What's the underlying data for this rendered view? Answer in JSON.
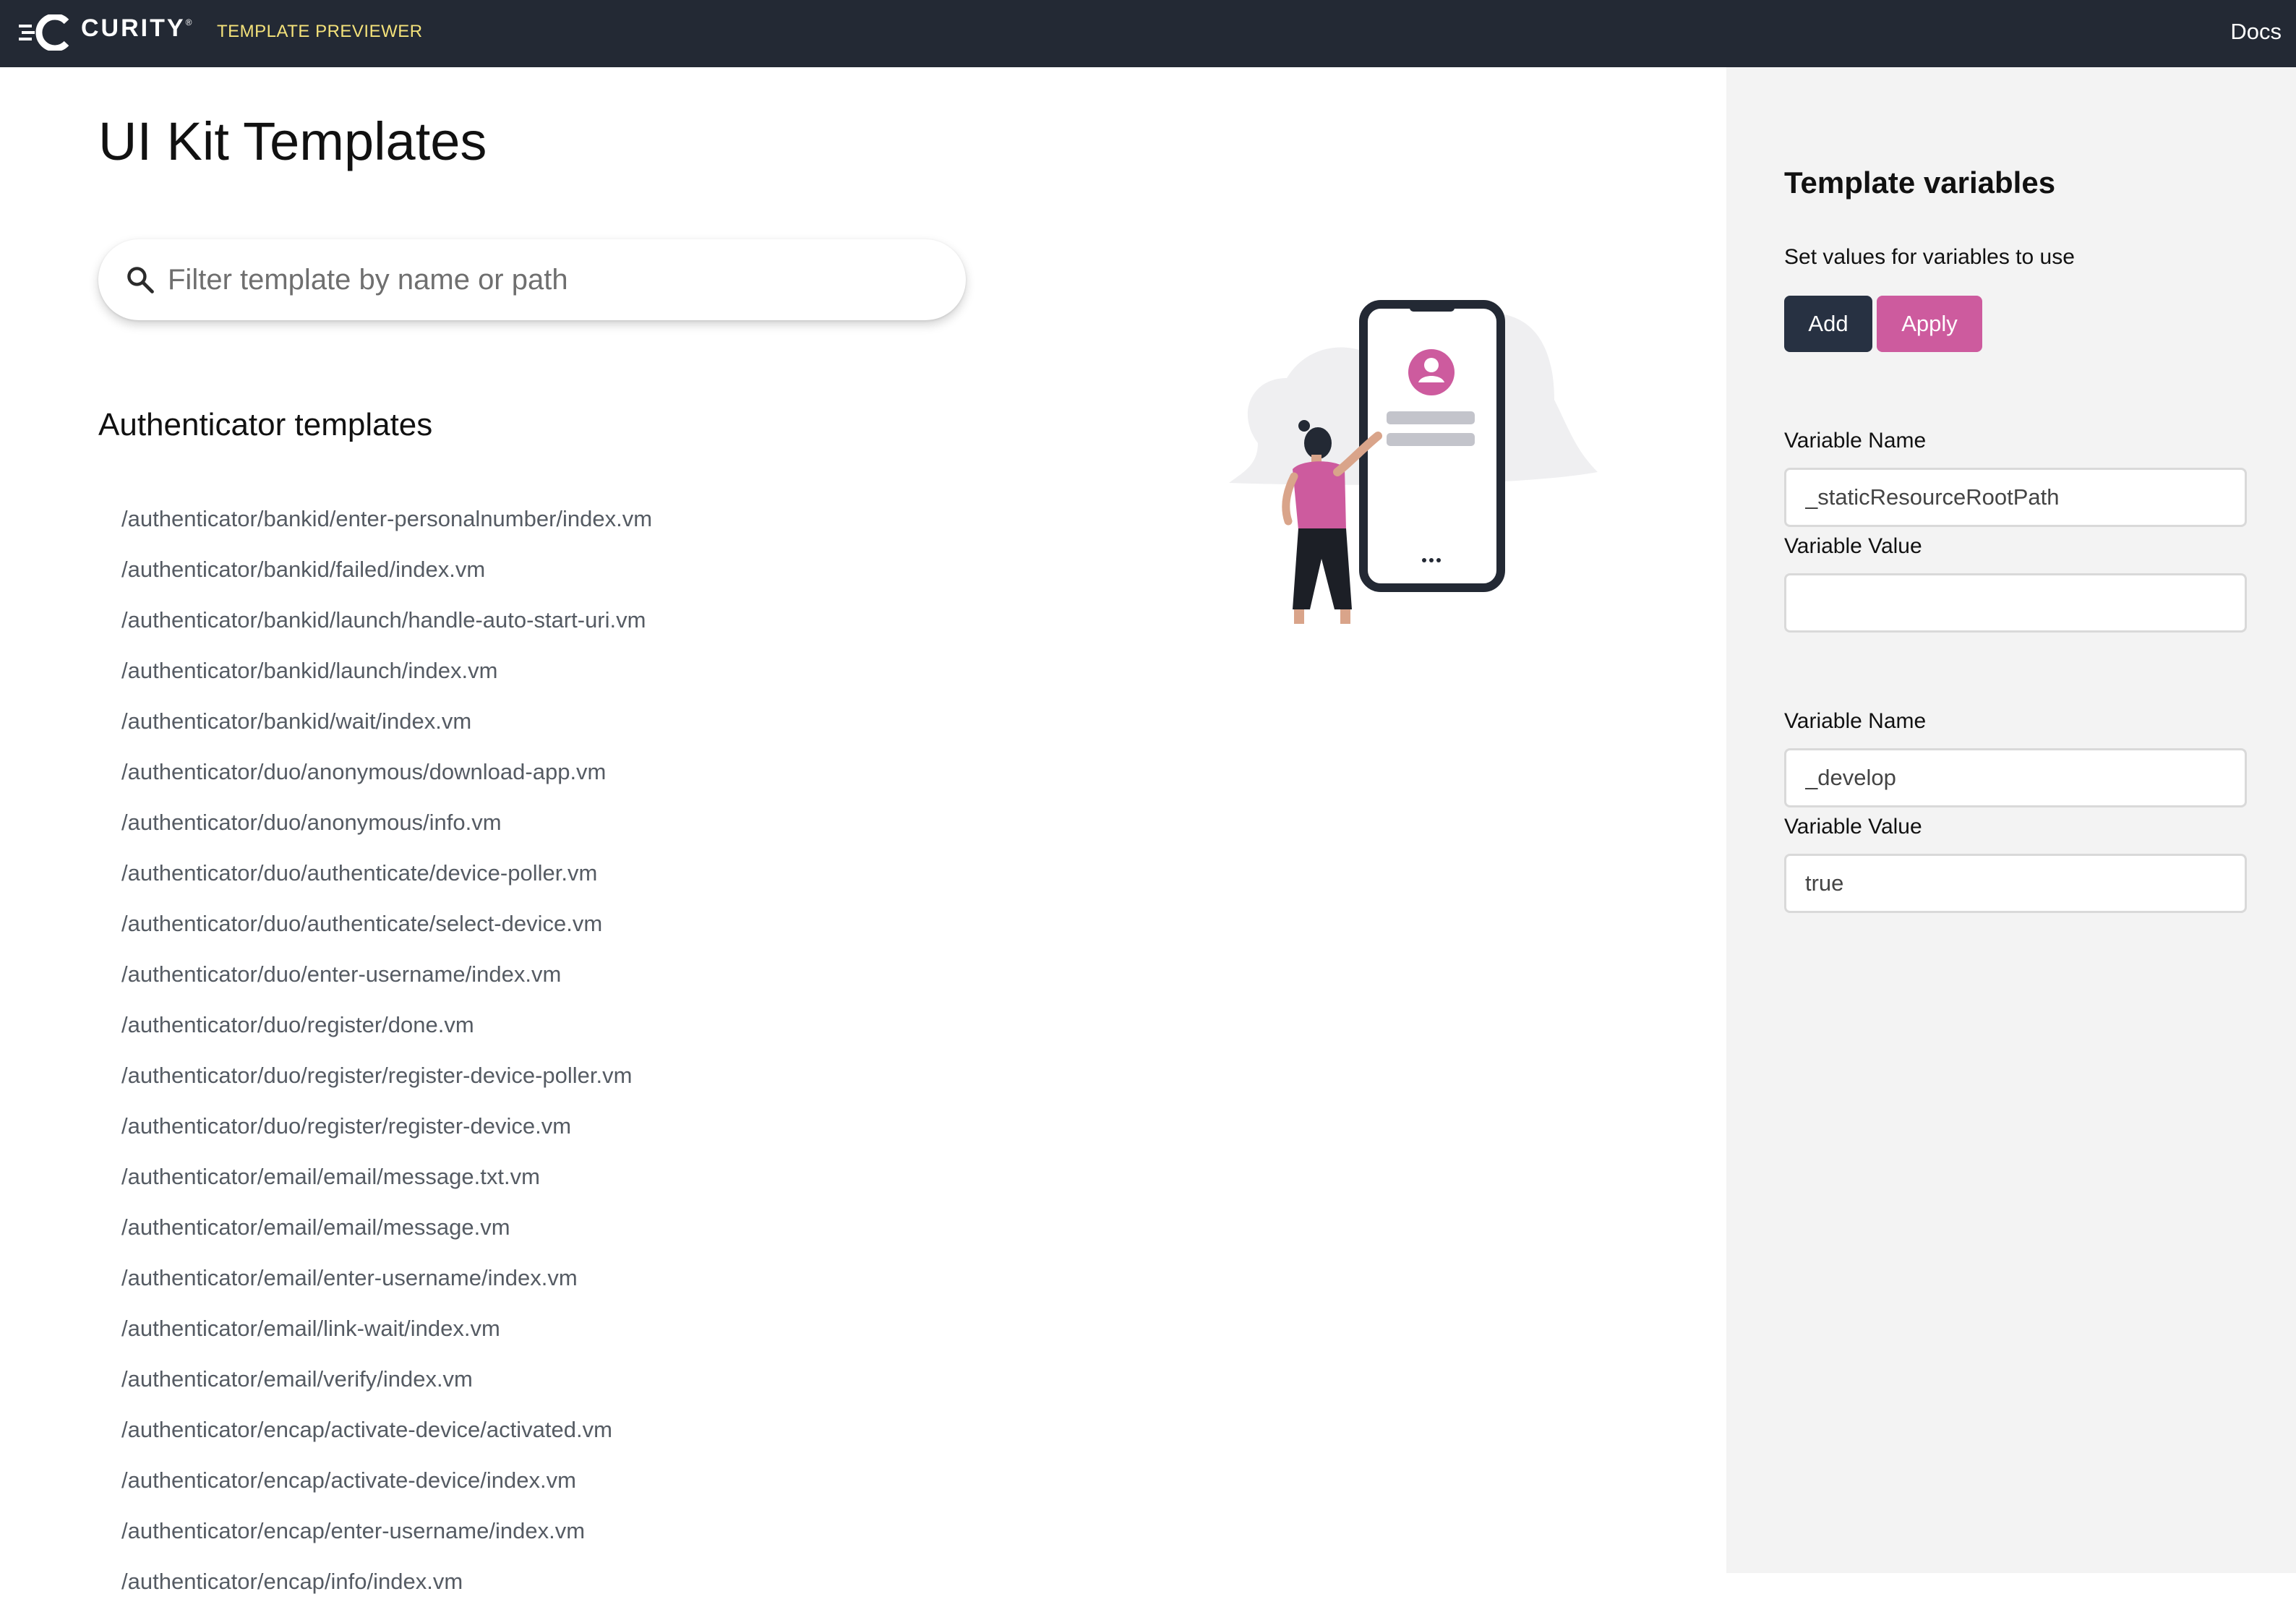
{
  "header": {
    "brand": "CURITY",
    "brand_mark": "®",
    "app_name": "TEMPLATE PREVIEWER",
    "docs_link": "Docs"
  },
  "main": {
    "title": "UI Kit Templates",
    "search": {
      "placeholder": "Filter template by name or path",
      "value": ""
    },
    "section_title": "Authenticator templates",
    "templates": [
      "/authenticator/bankid/enter-personalnumber/index.vm",
      "/authenticator/bankid/failed/index.vm",
      "/authenticator/bankid/launch/handle-auto-start-uri.vm",
      "/authenticator/bankid/launch/index.vm",
      "/authenticator/bankid/wait/index.vm",
      "/authenticator/duo/anonymous/download-app.vm",
      "/authenticator/duo/anonymous/info.vm",
      "/authenticator/duo/authenticate/device-poller.vm",
      "/authenticator/duo/authenticate/select-device.vm",
      "/authenticator/duo/enter-username/index.vm",
      "/authenticator/duo/register/done.vm",
      "/authenticator/duo/register/register-device-poller.vm",
      "/authenticator/duo/register/register-device.vm",
      "/authenticator/email/email/message.txt.vm",
      "/authenticator/email/email/message.vm",
      "/authenticator/email/enter-username/index.vm",
      "/authenticator/email/link-wait/index.vm",
      "/authenticator/email/verify/index.vm",
      "/authenticator/encap/activate-device/activated.vm",
      "/authenticator/encap/activate-device/index.vm",
      "/authenticator/encap/enter-username/index.vm",
      "/authenticator/encap/info/index.vm"
    ]
  },
  "side_panel": {
    "title": "Template variables",
    "subtitle": "Set values for variables to use",
    "add_label": "Add",
    "apply_label": "Apply",
    "variables": [
      {
        "name_label": "Variable Name",
        "name": "_staticResourceRootPath",
        "value_label": "Variable Value",
        "value": ""
      },
      {
        "name_label": "Variable Name",
        "name": "_develop",
        "value_label": "Variable Value",
        "value": "true"
      }
    ]
  },
  "colors": {
    "topbar": "#232934",
    "app_name": "#f4e27a",
    "accent_pink": "#cd5b9e",
    "button_dark": "#273142",
    "panel_bg": "#f3f3f3"
  },
  "icons": [
    "curity-logo-icon",
    "search-icon",
    "phone-login-illustration"
  ]
}
